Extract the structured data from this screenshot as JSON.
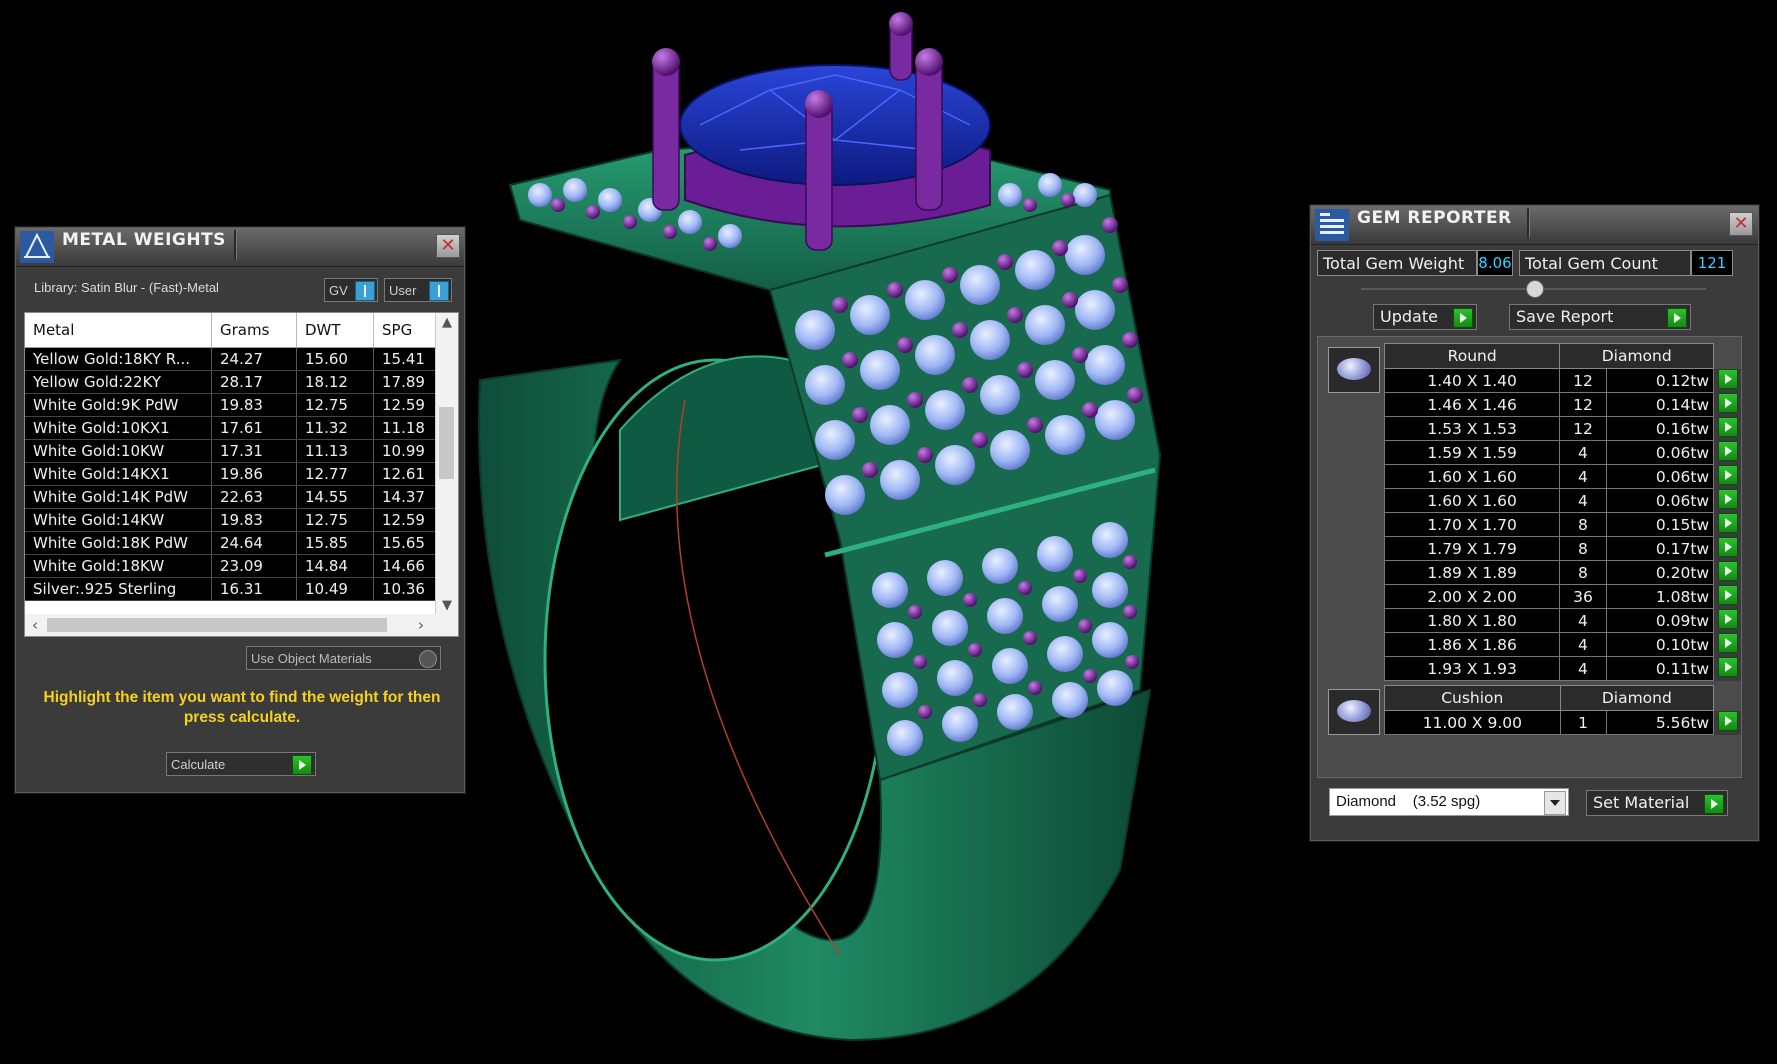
{
  "metal_weights": {
    "title": "METAL WEIGHTS",
    "library_label": "Library: Satin Blur - (Fast)-Metal",
    "toggle_gv": "GV",
    "toggle_user": "User",
    "columns": [
      "Metal",
      "Grams",
      "DWT",
      "SPG"
    ],
    "rows": [
      {
        "metal": "Yellow Gold:18KY R...",
        "grams": "24.27",
        "dwt": "15.60",
        "spg": "15.41"
      },
      {
        "metal": "Yellow Gold:22KY",
        "grams": "28.17",
        "dwt": "18.12",
        "spg": "17.89"
      },
      {
        "metal": "White Gold:9K PdW",
        "grams": "19.83",
        "dwt": "12.75",
        "spg": "12.59"
      },
      {
        "metal": "White Gold:10KX1",
        "grams": "17.61",
        "dwt": "11.32",
        "spg": "11.18"
      },
      {
        "metal": "White Gold:10KW",
        "grams": "17.31",
        "dwt": "11.13",
        "spg": "10.99"
      },
      {
        "metal": "White Gold:14KX1",
        "grams": "19.86",
        "dwt": "12.77",
        "spg": "12.61"
      },
      {
        "metal": "White Gold:14K PdW",
        "grams": "22.63",
        "dwt": "14.55",
        "spg": "14.37"
      },
      {
        "metal": "White Gold:14KW",
        "grams": "19.83",
        "dwt": "12.75",
        "spg": "12.59"
      },
      {
        "metal": "White Gold:18K PdW",
        "grams": "24.64",
        "dwt": "15.85",
        "spg": "15.65"
      },
      {
        "metal": "White Gold:18KW",
        "grams": "23.09",
        "dwt": "14.84",
        "spg": "14.66"
      },
      {
        "metal": "Silver:.925 Sterling",
        "grams": "16.31",
        "dwt": "10.49",
        "spg": "10.36"
      }
    ],
    "use_object_materials": "Use Object Materials",
    "hint": "Highlight the item you want to find the weight for then press calculate.",
    "calculate_label": "Calculate"
  },
  "gem_reporter": {
    "title": "GEM REPORTER",
    "total_weight_label": "Total Gem Weight",
    "total_weight_value": "8.06",
    "total_count_label": "Total Gem Count",
    "total_count_value": "121",
    "update_label": "Update",
    "save_report_label": "Save Report",
    "groups": [
      {
        "shape": "Round",
        "material": "Diamond",
        "rows": [
          {
            "size": "1.40 X 1.40",
            "count": "12",
            "weight": "0.12tw"
          },
          {
            "size": "1.46 X 1.46",
            "count": "12",
            "weight": "0.14tw"
          },
          {
            "size": "1.53 X 1.53",
            "count": "12",
            "weight": "0.16tw"
          },
          {
            "size": "1.59 X 1.59",
            "count": "4",
            "weight": "0.06tw"
          },
          {
            "size": "1.60 X 1.60",
            "count": "4",
            "weight": "0.06tw"
          },
          {
            "size": "1.60 X 1.60",
            "count": "4",
            "weight": "0.06tw"
          },
          {
            "size": "1.70 X 1.70",
            "count": "8",
            "weight": "0.15tw"
          },
          {
            "size": "1.79 X 1.79",
            "count": "8",
            "weight": "0.17tw"
          },
          {
            "size": "1.89 X 1.89",
            "count": "8",
            "weight": "0.20tw"
          },
          {
            "size": "2.00 X 2.00",
            "count": "36",
            "weight": "1.08tw"
          },
          {
            "size": "1.80 X 1.80",
            "count": "4",
            "weight": "0.09tw"
          },
          {
            "size": "1.86 X 1.86",
            "count": "4",
            "weight": "0.10tw"
          },
          {
            "size": "1.93 X 1.93",
            "count": "4",
            "weight": "0.11tw"
          }
        ]
      },
      {
        "shape": "Cushion",
        "material": "Diamond",
        "rows": [
          {
            "size": "11.00 X 9.00",
            "count": "1",
            "weight": "5.56tw"
          }
        ]
      }
    ],
    "material_select": "Diamond    (3.52 spg)",
    "set_material_label": "Set Material"
  },
  "colors": {
    "metal": "#1f7a5a",
    "prongs": "#7a1fa0",
    "center_stone": "#1a2fb0",
    "side_stones": "#a8c4ff",
    "hint_text": "#f5d21e",
    "value_text": "#33d1ff"
  }
}
